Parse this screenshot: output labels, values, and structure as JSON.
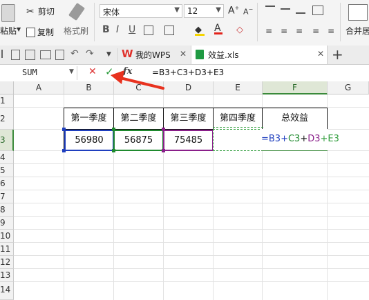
{
  "ribbon": {
    "paste_label": "粘贴",
    "cut_label": "剪切",
    "copy_label": "复制",
    "format_painter_label": "格式刷",
    "font_name": "宋体",
    "font_size": "12",
    "merge_label": "合并居"
  },
  "tabs": {
    "home_tab": "我的WPS",
    "file_tab": "效益.xls"
  },
  "formula_bar": {
    "name_box": "SUM",
    "formula": "=B3+C3+D3+E3"
  },
  "columns": [
    "A",
    "B",
    "C",
    "D",
    "E",
    "F",
    "G"
  ],
  "rows": [
    "1",
    "2",
    "3",
    "4",
    "5",
    "6",
    "7",
    "8",
    "9",
    "10",
    "11",
    "12",
    "13",
    "14"
  ],
  "sheet": {
    "headers": [
      "第一季度",
      "第二季度",
      "第三季度",
      "第四季度",
      "总效益"
    ],
    "values": [
      "56980",
      "56875",
      "75485",
      ""
    ],
    "f3_parts": [
      "=B3+",
      "C3",
      "+",
      "D3",
      "+E3"
    ]
  },
  "colors": {
    "b3_ref": "#1f3fbf",
    "c3_ref": "#1f8a2e",
    "d3_ref": "#8a1f8a",
    "e3_ref": "#2e9c3a",
    "arrow": "#e8321f"
  }
}
